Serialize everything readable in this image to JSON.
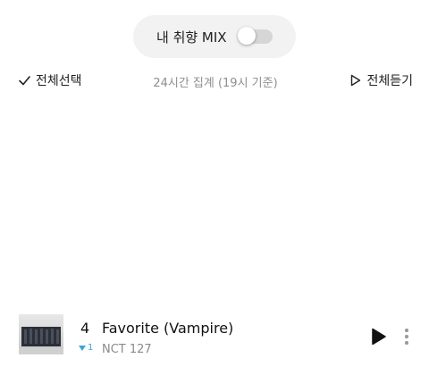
{
  "mix_toggle": {
    "label": "내 취향 MIX",
    "enabled": false
  },
  "toolbar": {
    "select_all_label": "전체선택",
    "chart_time_label": "24시간 집계 (19시 기준)",
    "play_all_label": "전체듣기"
  },
  "songs": [
    {
      "rank": "4",
      "rank_change": "1",
      "rank_change_direction": "down",
      "title": "Favorite (Vampire)",
      "artist": "NCT 127",
      "album_art_text": "FAVORITE"
    }
  ],
  "colors": {
    "rank_down": "#3aa6d6",
    "pill_background": "#f2f2f2"
  }
}
